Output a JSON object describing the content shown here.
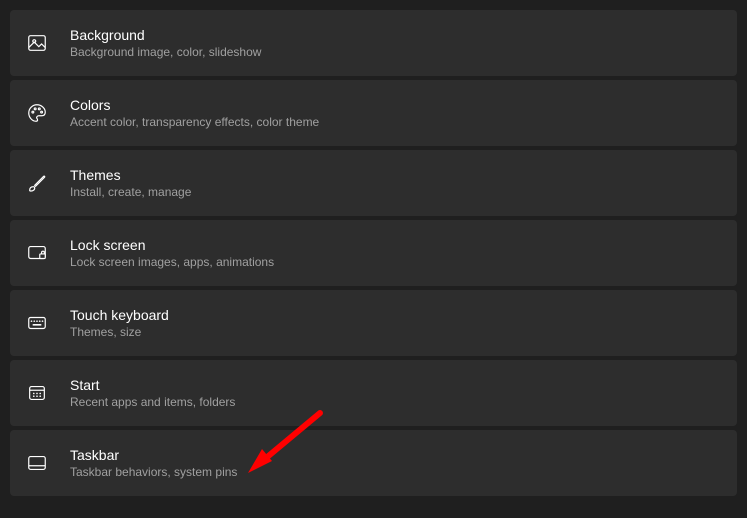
{
  "items": [
    {
      "id": "background",
      "title": "Background",
      "subtitle": "Background image, color, slideshow"
    },
    {
      "id": "colors",
      "title": "Colors",
      "subtitle": "Accent color, transparency effects, color theme"
    },
    {
      "id": "themes",
      "title": "Themes",
      "subtitle": "Install, create, manage"
    },
    {
      "id": "lockscreen",
      "title": "Lock screen",
      "subtitle": "Lock screen images, apps, animations"
    },
    {
      "id": "touchkb",
      "title": "Touch keyboard",
      "subtitle": "Themes, size"
    },
    {
      "id": "start",
      "title": "Start",
      "subtitle": "Recent apps and items, folders"
    },
    {
      "id": "taskbar",
      "title": "Taskbar",
      "subtitle": "Taskbar behaviors, system pins"
    }
  ],
  "annotation": {
    "color": "#ff0000"
  }
}
